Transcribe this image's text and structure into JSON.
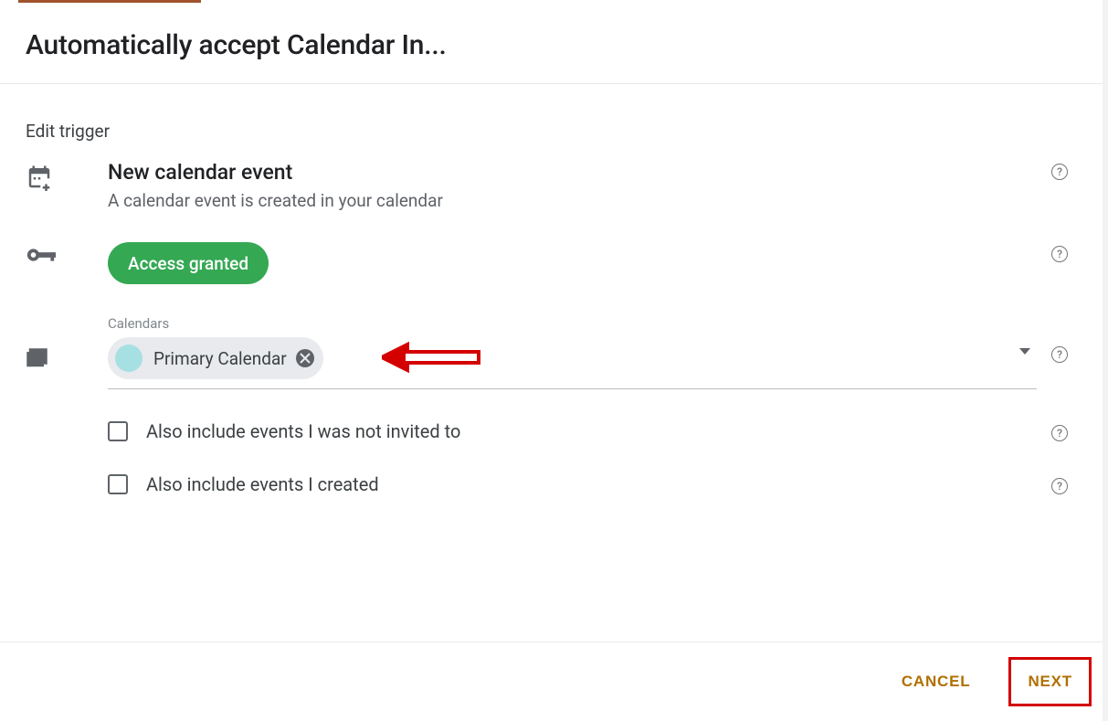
{
  "header": {
    "title": "Automatically accept Calendar In..."
  },
  "section_heading": "Edit trigger",
  "trigger": {
    "title": "New calendar event",
    "subtitle": "A calendar event is created in your calendar"
  },
  "access": {
    "badge": "Access granted"
  },
  "calendars": {
    "label": "Calendars",
    "chip": {
      "label": "Primary Calendar",
      "swatch_color": "#a7e0e2"
    }
  },
  "options": [
    {
      "label": "Also include events I was not invited to",
      "checked": false
    },
    {
      "label": "Also include events I created",
      "checked": false
    }
  ],
  "footer": {
    "cancel": "CANCEL",
    "next": "NEXT"
  },
  "help_glyph": "?"
}
